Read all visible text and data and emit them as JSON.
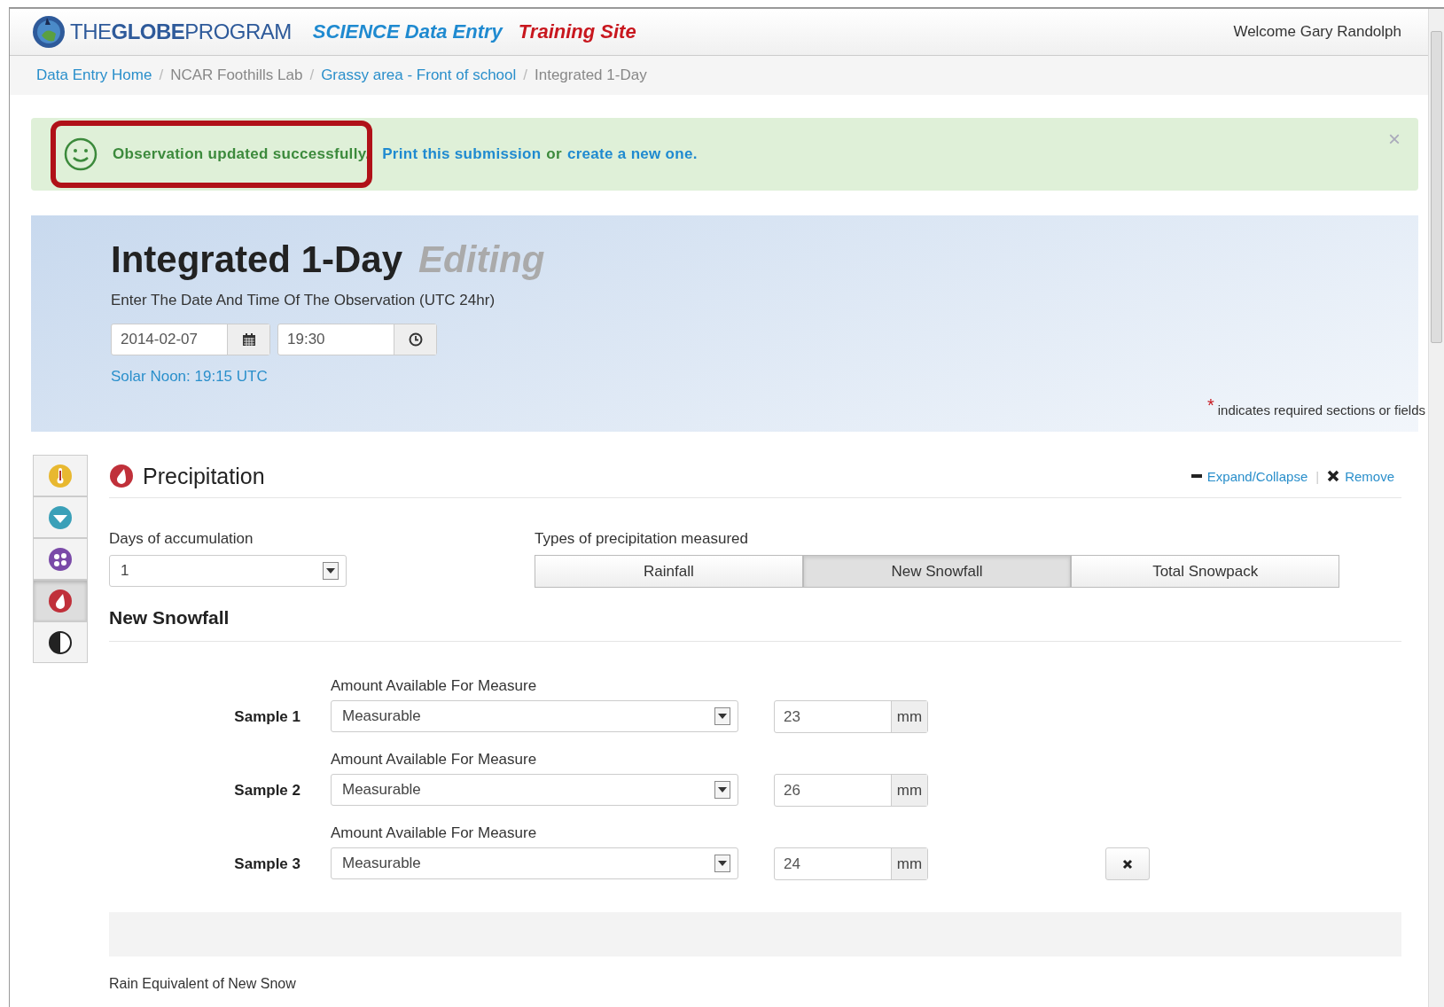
{
  "header": {
    "logo_text_1": "THE",
    "logo_text_2": "GLOBE",
    "logo_text_3": "PROGRAM",
    "app_title": "SCIENCE Data Entry",
    "site_label": "Training Site",
    "welcome": "Welcome Gary Randolph"
  },
  "breadcrumb": [
    {
      "label": "Data Entry Home",
      "link": true
    },
    {
      "separator": "/",
      "label": "NCAR Foothills Lab",
      "link": false
    },
    {
      "separator": "/",
      "label": "Grassy area - Front of school",
      "link": true
    },
    {
      "separator": "/",
      "label": "Integrated 1-Day",
      "link": false
    }
  ],
  "alert": {
    "message": "Observation updated successfully.",
    "link_1": "Print this submission",
    "joiner": "or",
    "link_2": "create a new one.",
    "close": "×",
    "highlighted": true
  },
  "observation": {
    "title": "Integrated 1-Day",
    "mode": "Editing",
    "prompt": "Enter The Date And Time Of The Observation (UTC 24hr)",
    "date": "2014-02-07",
    "time": "19:30",
    "solar_noon": "Solar Noon: 19:15 UTC",
    "required_mark": "*",
    "required_note": "indicates required sections or fields"
  },
  "sidebar": [
    {
      "kind": "thermometer",
      "selected": false
    },
    {
      "kind": "clouds",
      "selected": false
    },
    {
      "kind": "aerosols",
      "selected": false
    },
    {
      "kind": "precipitation",
      "selected": true
    },
    {
      "kind": "surface",
      "selected": false
    }
  ],
  "section": {
    "title": "Precipitation",
    "expand": "Expand/Collapse",
    "divider": "|",
    "remove": "Remove",
    "days_label": "Days of accumulation",
    "days_value": "1",
    "types_label": "Types of precipitation measured",
    "types": [
      {
        "label": "Rainfall",
        "selected": false
      },
      {
        "label": "New Snowfall",
        "selected": true
      },
      {
        "label": "Total Snowpack",
        "selected": false
      }
    ],
    "subsection": "New Snowfall",
    "samples": [
      {
        "label": "Sample 1",
        "amount_label": "Amount Available For Measure",
        "amount": "Measurable",
        "value": "23",
        "unit": "mm",
        "removable": false
      },
      {
        "label": "Sample 2",
        "amount_label": "Amount Available For Measure",
        "amount": "Measurable",
        "value": "26",
        "unit": "mm",
        "removable": false
      },
      {
        "label": "Sample 3",
        "amount_label": "Amount Available For Measure",
        "amount": "Measurable",
        "value": "24",
        "unit": "mm",
        "removable": true
      }
    ],
    "next_label": "Rain Equivalent of New Snow"
  }
}
